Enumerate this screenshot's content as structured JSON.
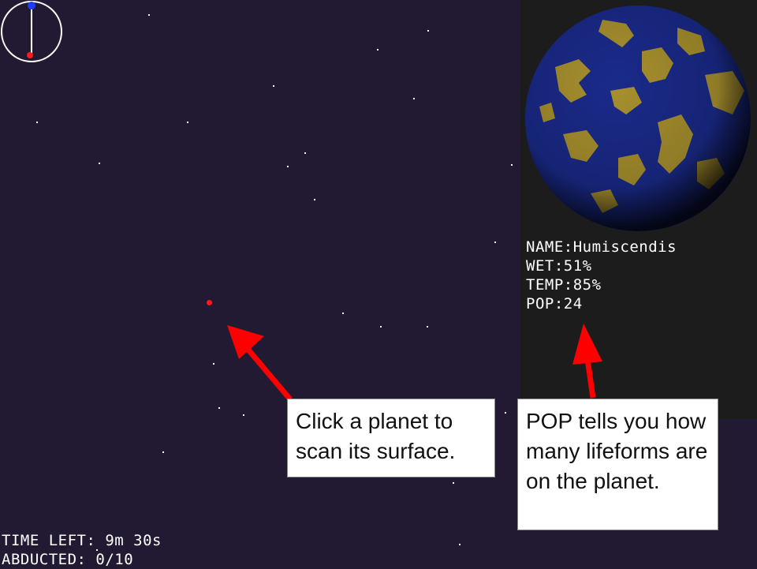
{
  "hud": {
    "time_left": "TIME LEFT: 9m 30s",
    "abducted": "ABDUCTED: 0/10"
  },
  "scan": {
    "name": "NAME:Humiscendis",
    "wet": "WET:51%",
    "temp": "TEMP:85%",
    "pop": "POP:24"
  },
  "tutorial": {
    "click_hint": "Click a planet to scan its surface.",
    "pop_hint": "POP tells you how many lifeforms are on the planet."
  },
  "colors": {
    "space": "#221a33",
    "panel": "#1c1c1c",
    "planet_water": "#1a2a8a",
    "planet_land": "#a8902e",
    "marker": "#ff1a1a",
    "compass_north": "#1e3cff"
  },
  "icons": {
    "compass": "compass-icon",
    "planet_marker": "planet-dot-icon",
    "arrow": "arrow-icon"
  }
}
